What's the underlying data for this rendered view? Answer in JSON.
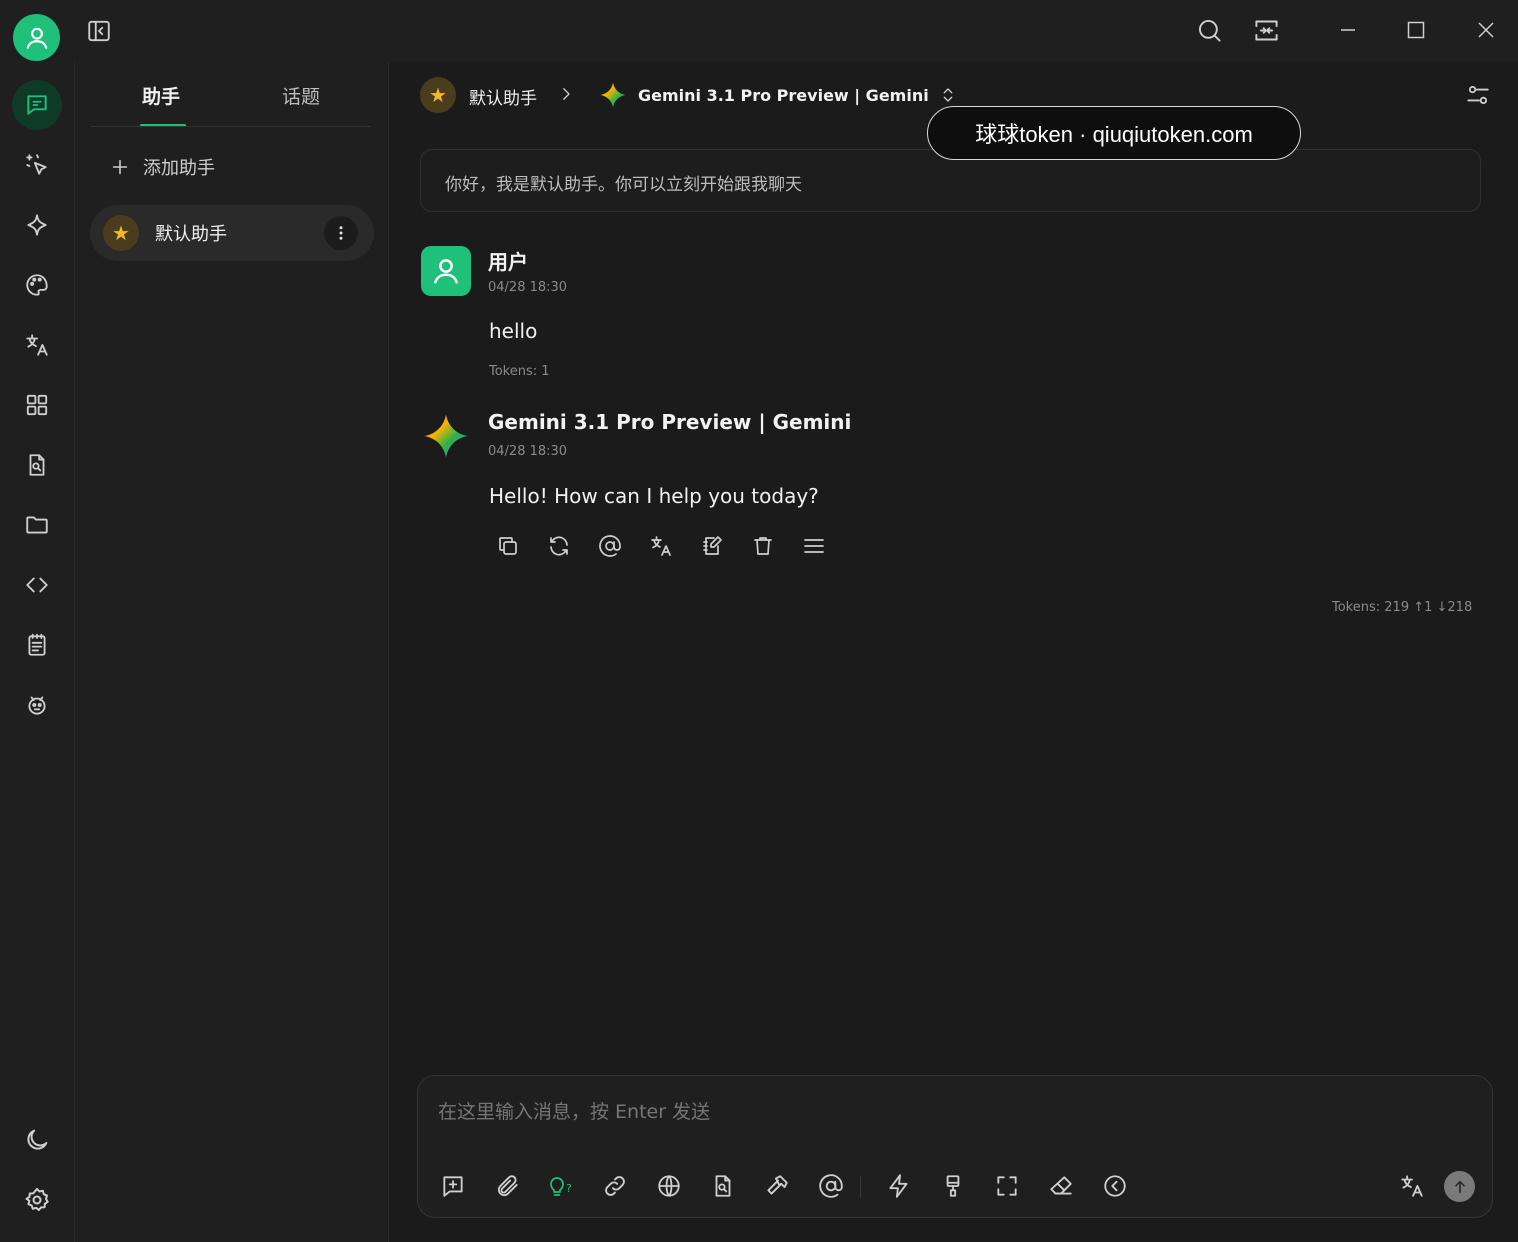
{
  "app": {
    "user_avatar_icon": "user-icon",
    "accent": "#1ec07a"
  },
  "sidebar_tabs": {
    "assistants": "助手",
    "topics": "话题"
  },
  "add_assistant_label": "添加助手",
  "assistants": [
    {
      "name": "默认助手",
      "icon": "star-icon"
    }
  ],
  "header": {
    "assistant_name": "默认助手",
    "model_name": "Gemini 3.1 Pro Preview | Gemini"
  },
  "watermark": "球球token · qiuqiutoken.com",
  "intro_message": "你好，我是默认助手。你可以立刻开始跟我聊天",
  "messages": [
    {
      "role": "user",
      "name": "用户",
      "time": "04/28 18:30",
      "text": "hello",
      "tokens": "Tokens: 1"
    },
    {
      "role": "assistant",
      "name": "Gemini 3.1 Pro Preview | Gemini",
      "time": "04/28 18:30",
      "text": "Hello! How can I help you today?",
      "tokens": "Tokens: 219  ↑1  ↓218"
    }
  ],
  "input": {
    "placeholder": "在这里输入消息，按 Enter 发送"
  }
}
